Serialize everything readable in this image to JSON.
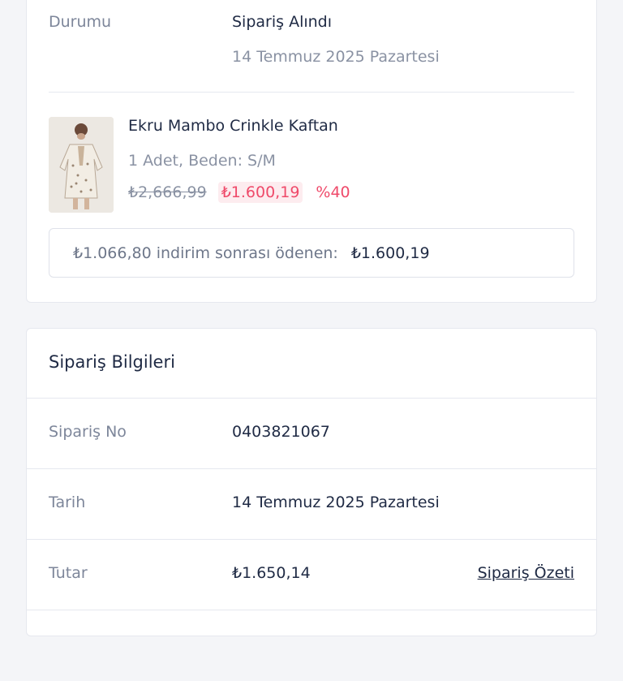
{
  "order_status": {
    "label": "Durumu",
    "value": "Sipariş Alındı",
    "date": "14 Temmuz 2025 Pazartesi"
  },
  "product": {
    "name": "Ekru Mambo Crinkle Kaftan",
    "quantity_size": "1 Adet, Beden: S/M",
    "old_price": "₺2,666,99",
    "new_price": "₺1.600,19",
    "discount": "%40",
    "image_icon": "kaftan-product-photo"
  },
  "paid_summary": {
    "text": "₺1.066,80 indirim sonrası ödenen:",
    "amount": "₺1.600,19"
  },
  "order_info": {
    "title": "Sipariş Bilgileri",
    "rows": [
      {
        "label": "Sipariş No",
        "value": "0403821067"
      },
      {
        "label": "Tarih",
        "value": "14 Temmuz 2025 Pazartesi"
      },
      {
        "label": "Tutar",
        "value": "₺1.650,14",
        "link": "Sipariş Özeti"
      }
    ]
  },
  "colors": {
    "accent_discount": "#ef4a6a",
    "text_primary": "#1f2a44",
    "text_muted": "#8a92a3",
    "background": "#f4f5f8"
  }
}
